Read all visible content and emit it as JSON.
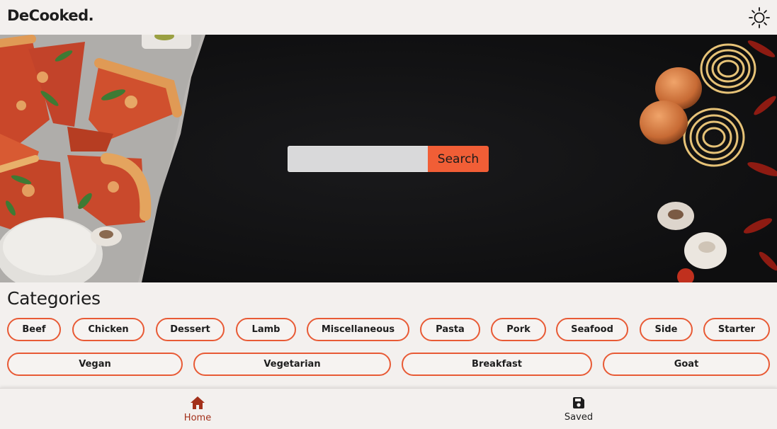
{
  "app": {
    "title": "DeCooked."
  },
  "header": {
    "theme_icon": "sun-icon"
  },
  "search": {
    "value": "",
    "placeholder": "",
    "button_label": "Search"
  },
  "categories": {
    "title": "Categories",
    "row1": [
      "Beef",
      "Chicken",
      "Dessert",
      "Lamb",
      "Miscellaneous",
      "Pasta",
      "Pork",
      "Seafood",
      "Side",
      "Starter"
    ],
    "row2": [
      "Vegan",
      "Vegetarian",
      "Breakfast",
      "Goat"
    ]
  },
  "nav": {
    "home": {
      "label": "Home",
      "icon": "home-icon"
    },
    "saved": {
      "label": "Saved",
      "icon": "save-icon"
    }
  },
  "colors": {
    "accent": "#f15e36",
    "chip_border": "#e85a35",
    "active_nav": "#a3301a",
    "background": "#f3f0ee"
  }
}
